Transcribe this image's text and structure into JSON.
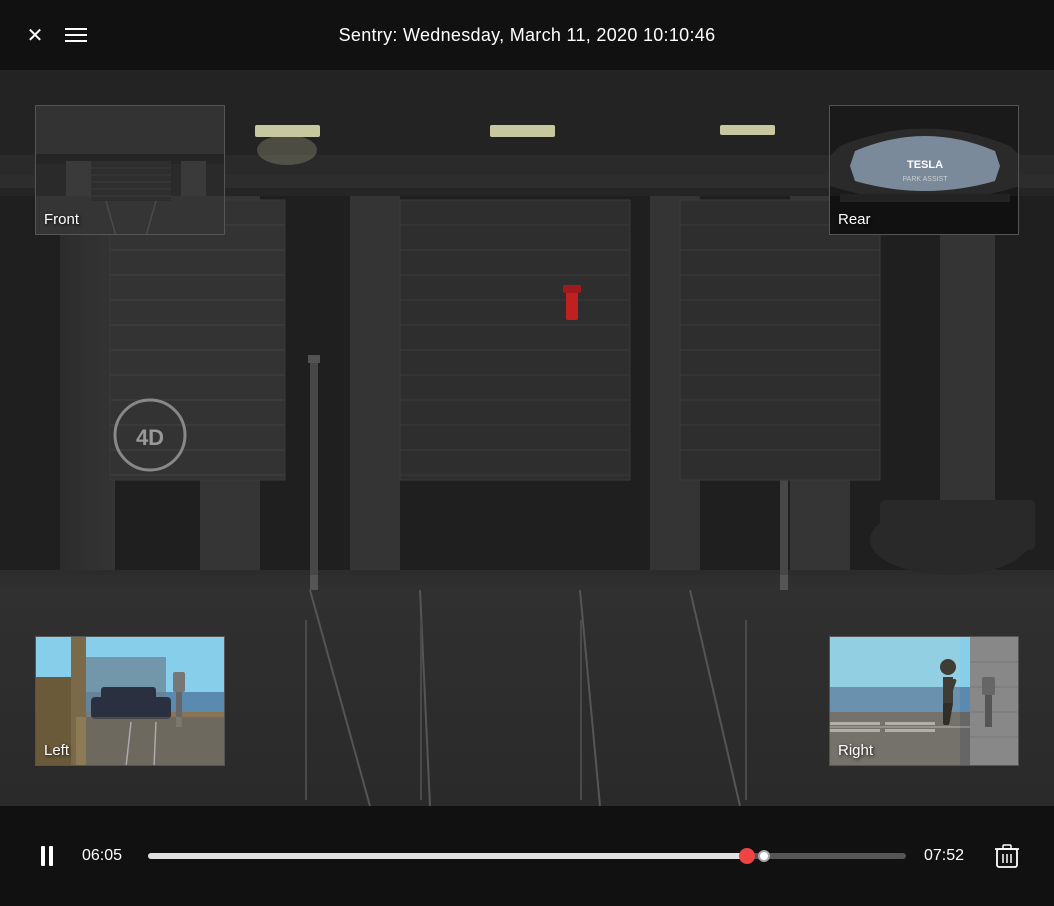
{
  "header": {
    "title": "Sentry: Wednesday, March 11, 2020 10:10:46",
    "close_label": "×",
    "menu_label": "menu"
  },
  "cameras": {
    "front": {
      "label": "Front"
    },
    "rear": {
      "label": "Rear"
    },
    "left": {
      "label": "Left"
    },
    "right": {
      "label": "Right"
    }
  },
  "controls": {
    "time_current": "06:05",
    "time_total": "07:52",
    "progress_percent": 79,
    "play_state": "paused"
  },
  "icons": {
    "close": "✕",
    "delete": "🗑"
  }
}
